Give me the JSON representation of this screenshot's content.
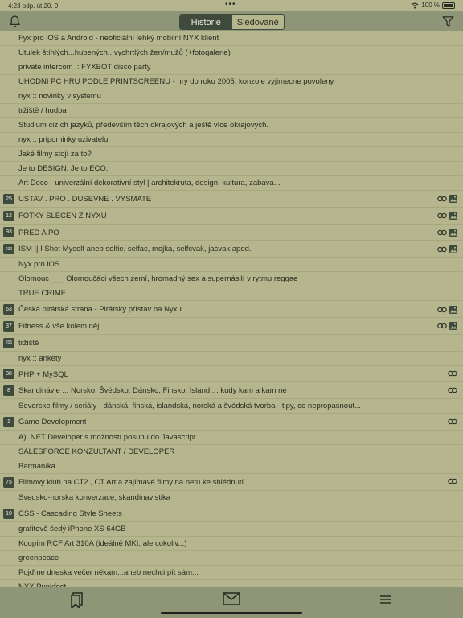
{
  "status_bar": {
    "time": "4:23 odp.  út 20. 9.",
    "dots": "•••",
    "battery": "100 %"
  },
  "header": {
    "tabs": [
      "Historie",
      "Sledované"
    ],
    "active_tab": "Historie",
    "bell_icon": "bell-icon",
    "filter_icon": "filter-icon"
  },
  "colors": {
    "background": "#b5b68e",
    "bars": "#8e9677",
    "accent": "#3e4a3b",
    "text": "#2a2d22"
  },
  "list": [
    {
      "title": "Fyx pro iOS a Android - neoficiální lehký mobilní NYX klient",
      "count": "",
      "link": false,
      "image": false
    },
    {
      "title": "Utulek štíhlých...hubených...vychrtlých žen/mužů (+fotogalerie)",
      "count": "",
      "link": false,
      "image": false
    },
    {
      "title": "private intercom :: FYXBOT disco party",
      "count": "",
      "link": false,
      "image": false
    },
    {
      "title": "UHODNI PC HRU PODLE PRINTSCREENU - hry do roku 2005, konzole vyjimecne povoleny",
      "count": "",
      "link": false,
      "image": false
    },
    {
      "title": "nyx :: novinky v systemu",
      "count": "",
      "link": false,
      "image": false
    },
    {
      "title": "tržiště / hudba",
      "count": "",
      "link": false,
      "image": false
    },
    {
      "title": "Studium cizích jazyků, především těch okrajových a ještě více okrajových.",
      "count": "",
      "link": false,
      "image": false
    },
    {
      "title": "nyx :: pripominky uzivatelu",
      "count": "",
      "link": false,
      "image": false
    },
    {
      "title": "Jaké filmy stojí za to?",
      "count": "",
      "link": false,
      "image": false
    },
    {
      "title": "Je to DESIGN. Je to ECO.",
      "count": "",
      "link": false,
      "image": false
    },
    {
      "title": "Art Deco - univerzální dekorativní styl | architekruta, design, kultura, zabava...",
      "count": "",
      "link": false,
      "image": false
    },
    {
      "title": "USTAV . PRO . DUSEVNE . VYSMATE",
      "count": "25",
      "link": true,
      "image": true
    },
    {
      "title": "FOTKY SLECEN Z NYXU",
      "count": "12",
      "link": true,
      "image": true
    },
    {
      "title": "PŘED A PO",
      "count": "93",
      "link": true,
      "image": true
    },
    {
      "title": "ISM || I Shot Myself aneb selfie, selfac, mojka, selfcvak, jacvak apod.",
      "count": "230",
      "link": true,
      "image": true
    },
    {
      "title": "Nyx pro iOS",
      "count": "",
      "link": false,
      "image": false
    },
    {
      "title": "Olomouc ___ Olomoučáci všech zemí, hromadný sex a supernásilí v rytmu reggae",
      "count": "",
      "link": false,
      "image": false
    },
    {
      "title": "TRUE CRIME",
      "count": "",
      "link": false,
      "image": false
    },
    {
      "title": "Česká pirátská strana - Pirátský přístav na Nyxu",
      "count": "63",
      "link": true,
      "image": true
    },
    {
      "title": "Fitness & vše kolem něj",
      "count": "37",
      "link": true,
      "image": true
    },
    {
      "title": "tržiště",
      "count": "205",
      "link": false,
      "image": false
    },
    {
      "title": "nyx :: ankety",
      "count": "",
      "link": false,
      "image": false
    },
    {
      "title": "PHP + MySQL",
      "count": "38",
      "link": true,
      "image": false
    },
    {
      "title": "Skandinávie ... Norsko, Švédsko, Dánsko, Finsko, Island ... kudy kam a kam ne",
      "count": "8",
      "link": true,
      "image": false
    },
    {
      "title": "Severske filmy / seriály - dánská, finská, islandská, norská a švédská tvorba - tipy, co nepropasnout...",
      "count": "",
      "link": false,
      "image": false
    },
    {
      "title": "Game Development",
      "count": "1",
      "link": true,
      "image": false
    },
    {
      "title": "A) .NET Developer s možností posunu do Javascript",
      "count": "",
      "link": false,
      "image": false
    },
    {
      "title": "SALESFORCE KONZULTANT / DEVELOPER",
      "count": "",
      "link": false,
      "image": false
    },
    {
      "title": "Barman/ka",
      "count": "",
      "link": false,
      "image": false
    },
    {
      "title": "Filmovy klub na CT2 , CT Art a zajímavé filmy na netu ke shlédnutí",
      "count": "75",
      "link": true,
      "image": false
    },
    {
      "title": "Svedsko-norska konverzace, skandinavistika",
      "count": "",
      "link": false,
      "image": false
    },
    {
      "title": "CSS - Cascading Style Sheets",
      "count": "10",
      "link": false,
      "image": false
    },
    {
      "title": "grafitově šedý iPhone XS 64GB",
      "count": "",
      "link": false,
      "image": false
    },
    {
      "title": "Koupím RCF Art 310A (ideálně MKI, ale cokoliv...)",
      "count": "",
      "link": false,
      "image": false
    },
    {
      "title": "greenpeace",
      "count": "",
      "link": false,
      "image": false
    },
    {
      "title": "Pojďme dneska večer někam...aneb nechci pít sám...",
      "count": "",
      "link": false,
      "image": false
    },
    {
      "title": "NYX Punkfest",
      "count": "",
      "link": false,
      "image": false
    }
  ],
  "tabbar": {
    "items": [
      "bookmarks-icon",
      "mail-icon",
      "menu-icon"
    ]
  }
}
